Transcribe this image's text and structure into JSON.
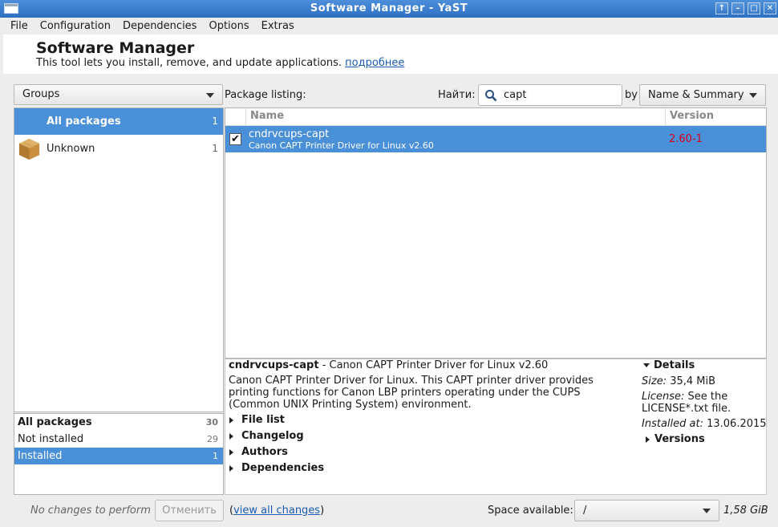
{
  "window": {
    "title": "Software Manager - YaST",
    "buttons": [
      "↑",
      "–",
      "□",
      "✕"
    ]
  },
  "menu": [
    "File",
    "Configuration",
    "Dependencies",
    "Options",
    "Extras"
  ],
  "header": {
    "title": "Software Manager",
    "description": "This tool lets you install, remove, and update applications.",
    "link": "подробнее"
  },
  "groups": {
    "combo_label": "Groups",
    "items": [
      {
        "label": "All packages",
        "count": "1",
        "selected": true
      },
      {
        "label": "Unknown",
        "count": "1",
        "icon": "package-box-icon"
      }
    ]
  },
  "filters": [
    {
      "label": "All packages",
      "count": "30",
      "bold": true
    },
    {
      "label": "Not installed",
      "count": "29"
    },
    {
      "label": "Installed",
      "count": "1",
      "selected": true
    }
  ],
  "search": {
    "package_listing_label": "Package listing:",
    "find_label": "Найти:",
    "value": "capt",
    "by_label": "by",
    "by_value": "Name & Summary"
  },
  "table": {
    "columns": [
      "Name",
      "Version"
    ],
    "rows": [
      {
        "checked": true,
        "name": "cndrvcups-capt",
        "summary": "Canon CAPT Printer Driver for Linux v2.60",
        "version": "2.60-1"
      }
    ]
  },
  "details": {
    "name": "cndrvcups-capt",
    "summary": " - Canon CAPT Printer Driver for Linux v2.60",
    "description": "Canon CAPT Printer Driver for Linux. This CAPT printer driver provides printing functions for Canon LBP printers operating under the CUPS (Common UNIX Printing System) environment.",
    "expanders": [
      "File list",
      "Changelog",
      "Authors",
      "Dependencies"
    ],
    "side": {
      "header": "Details",
      "size_label": "Size:",
      "size_value": " 35,4 MiB",
      "license_label": "License:",
      "license_value": " See the LICENSE*.txt file.",
      "installed_label": "Installed at:",
      "installed_value": " 13.06.2015",
      "versions": "Versions"
    }
  },
  "statusbar": {
    "no_changes": "No changes to perform",
    "cancel": "Отменить",
    "view_all_open": "(",
    "view_all": "view all changes",
    "view_all_close": ")",
    "space_label": "Space available:",
    "space_value": "/",
    "space_size": "1,58 GiB"
  }
}
